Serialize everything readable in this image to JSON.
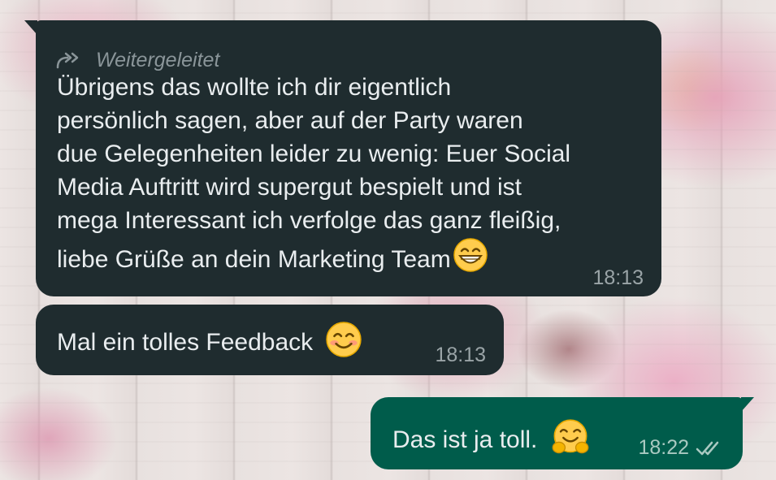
{
  "messages": [
    {
      "direction": "incoming",
      "forwarded_label": "Weitergeleitet",
      "lines": [
        "Übrigens das wollte ich dir eigentlich",
        "persönlich sagen, aber auf der Party waren",
        "due Gelegenheiten leider zu wenig: Euer Social",
        "Media Auftritt wird supergut bespielt und ist",
        "mega Interessant ich verfolge das ganz fleißig,",
        "liebe Grüße an dein Marketing Team"
      ],
      "emoji": "grinning-face-with-smiling-eyes",
      "time": "18:13"
    },
    {
      "direction": "incoming",
      "text": "Mal ein tolles Feedback",
      "emoji": "smiling-face-with-smiling-eyes",
      "time": "18:13"
    },
    {
      "direction": "outgoing",
      "text": "Das ist ja toll.",
      "emoji": "hugging-face",
      "time": "18:22",
      "status": "read-double-check"
    }
  ],
  "colors": {
    "incoming_bubble": "#1f2c2f",
    "outgoing_bubble": "#005c4b",
    "message_text": "#e9edef",
    "timestamp": "#9aa4a7"
  }
}
